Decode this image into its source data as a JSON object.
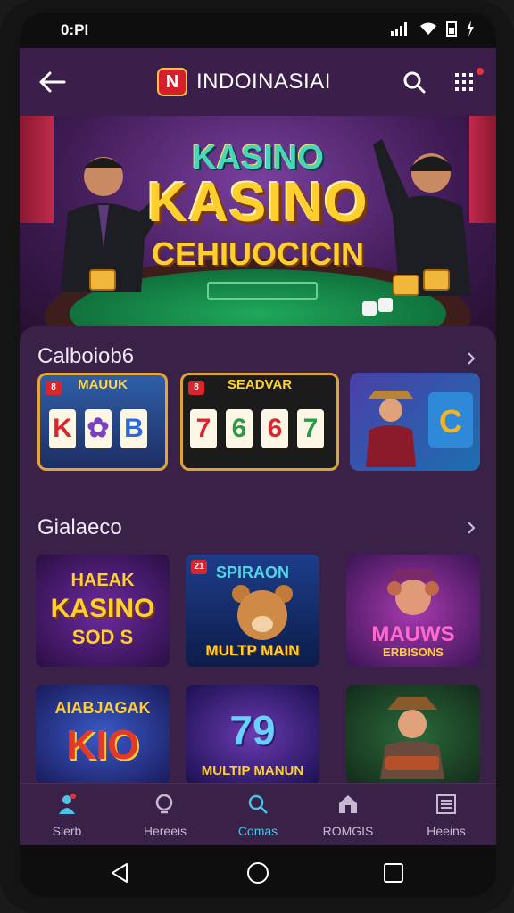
{
  "status": {
    "time": "0:PI"
  },
  "appbar": {
    "logo_letter": "N",
    "title": "INDOINASIAI"
  },
  "hero": {
    "small_text": "KASINO",
    "big_text": "KASINO",
    "sub_text": "CEHIUOCICIN"
  },
  "sections": [
    {
      "title": "Calboiob6",
      "cards": [
        {
          "top_label": "MAUUK",
          "badge": "8",
          "reels": [
            "K",
            "✿",
            "B"
          ]
        },
        {
          "top_label": "SEADVAR",
          "badge": "8",
          "reels": [
            "7",
            "6",
            "6",
            "7"
          ]
        },
        {
          "top_label": "",
          "badge": "",
          "reels": [
            "C"
          ]
        }
      ]
    },
    {
      "title": "Gialaeco",
      "cards": [
        {
          "line1": "HAEAK",
          "line2": "KASINO",
          "line3": "SOD S",
          "badge": ""
        },
        {
          "line1": "SPIRAON",
          "line2": "",
          "line3": "MULTP MAIN",
          "badge": "21"
        },
        {
          "line1": "",
          "line2": "MAUWS",
          "line3": "ERBISONS",
          "badge": ""
        },
        {
          "line1": "AIABJAGAK",
          "line2": "KIO",
          "line3": "",
          "badge": ""
        },
        {
          "line1": "",
          "line2": "79",
          "line3": "MULTIP MANUN",
          "badge": ""
        },
        {
          "line1": "",
          "line2": "",
          "line3": "",
          "badge": ""
        }
      ]
    }
  ],
  "nav": [
    {
      "label": "Slerb",
      "icon": "person-icon"
    },
    {
      "label": "Hereeis",
      "icon": "magnifier-icon"
    },
    {
      "label": "Comas",
      "icon": "search-icon"
    },
    {
      "label": "ROMGIS",
      "icon": "house-icon"
    },
    {
      "label": "Heeins",
      "icon": "list-icon"
    }
  ],
  "colors": {
    "background": "#2a1636",
    "appbar": "#3b1e49",
    "panel": "#3a2148",
    "accent_gold": "#ffcf2e",
    "accent_active": "#4cc3e6"
  }
}
